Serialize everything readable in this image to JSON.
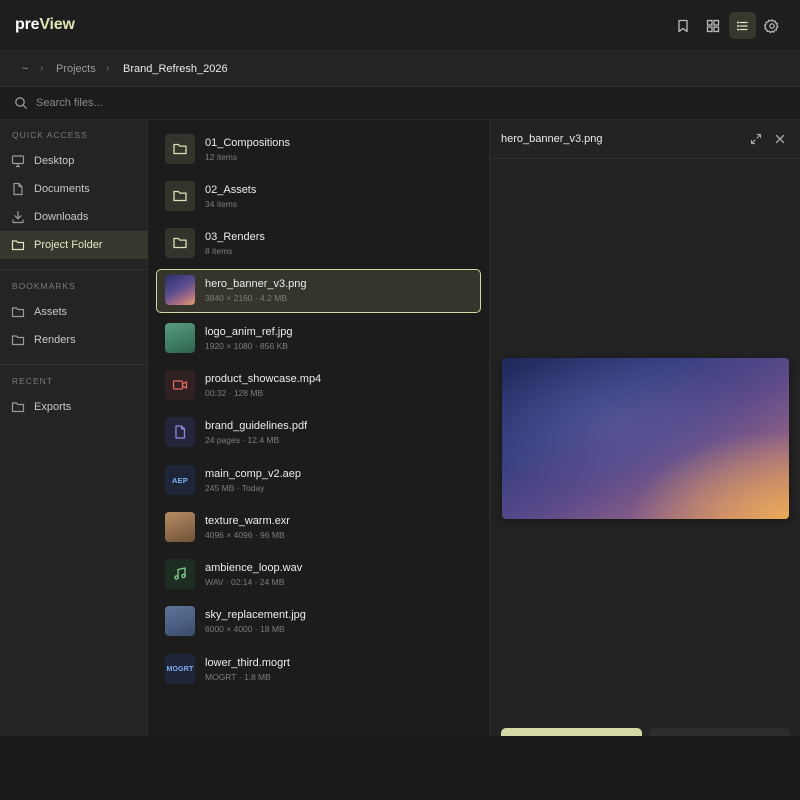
{
  "app": {
    "logo_main": "pre",
    "logo_accent": "View"
  },
  "toolbar": {
    "buttons": [
      {
        "name": "bookmark-button",
        "icon": "bookmark-icon"
      },
      {
        "name": "grid-view-button",
        "icon": "grid-icon"
      },
      {
        "name": "list-view-button",
        "icon": "list-icon",
        "active": true
      },
      {
        "name": "settings-button",
        "icon": "gear-icon"
      }
    ]
  },
  "breadcrumb": {
    "home": "~",
    "items": [
      "Projects",
      "Brand_Refresh_2026"
    ],
    "separator": "›"
  },
  "search": {
    "placeholder": "Search files...",
    "value": ""
  },
  "sidebar": {
    "quick_access_label": "QUICK ACCESS",
    "quick_access": [
      {
        "label": "Desktop",
        "icon": "monitor-icon"
      },
      {
        "label": "Documents",
        "icon": "document-icon"
      },
      {
        "label": "Downloads",
        "icon": "download-icon"
      },
      {
        "label": "Project Folder",
        "icon": "folder-icon",
        "active": true
      }
    ],
    "bookmarks_label": "BOOKMARKS",
    "bookmarks": [
      {
        "label": "Assets",
        "icon": "folder-icon"
      },
      {
        "label": "Renders",
        "icon": "folder-icon"
      }
    ],
    "recent_label": "RECENT",
    "recent": [
      {
        "label": "Exports",
        "icon": "folder-icon"
      }
    ]
  },
  "files": [
    {
      "name": "01_Compositions",
      "meta": "12 items",
      "kind": "folder"
    },
    {
      "name": "02_Assets",
      "meta": "34 items",
      "kind": "folder"
    },
    {
      "name": "03_Renders",
      "meta": "8 items",
      "kind": "folder"
    },
    {
      "name": "hero_banner_v3.png",
      "meta": "3840 × 2160 · 4.2 MB",
      "kind": "image-hero",
      "selected": true
    },
    {
      "name": "logo_anim_ref.jpg",
      "meta": "1920 × 1080 · 856 KB",
      "kind": "image-green"
    },
    {
      "name": "product_showcase.mp4",
      "meta": "00:32 · 128 MB",
      "kind": "video"
    },
    {
      "name": "brand_guidelines.pdf",
      "meta": "24 pages · 12.4 MB",
      "kind": "pdf"
    },
    {
      "name": "main_comp_v2.aep",
      "meta": "245 MB · Today",
      "kind": "aep",
      "tag": "AEP"
    },
    {
      "name": "texture_warm.exr",
      "meta": "4096 × 4096 · 96 MB",
      "kind": "image-warm"
    },
    {
      "name": "ambience_loop.wav",
      "meta": "WAV · 02:14 · 24 MB",
      "kind": "audio"
    },
    {
      "name": "sky_replacement.jpg",
      "meta": "6000 × 4000 · 18 MB",
      "kind": "image-sky"
    },
    {
      "name": "lower_third.mogrt",
      "meta": "MOGRT · 1.8 MB",
      "kind": "mogrt",
      "tag": "MOGRT"
    }
  ],
  "preview": {
    "title": "hero_banner_v3.png"
  },
  "colors": {
    "accent": "#e1e3b3",
    "selection_border": "#d4d8a2",
    "active_bg": "#36372d"
  }
}
